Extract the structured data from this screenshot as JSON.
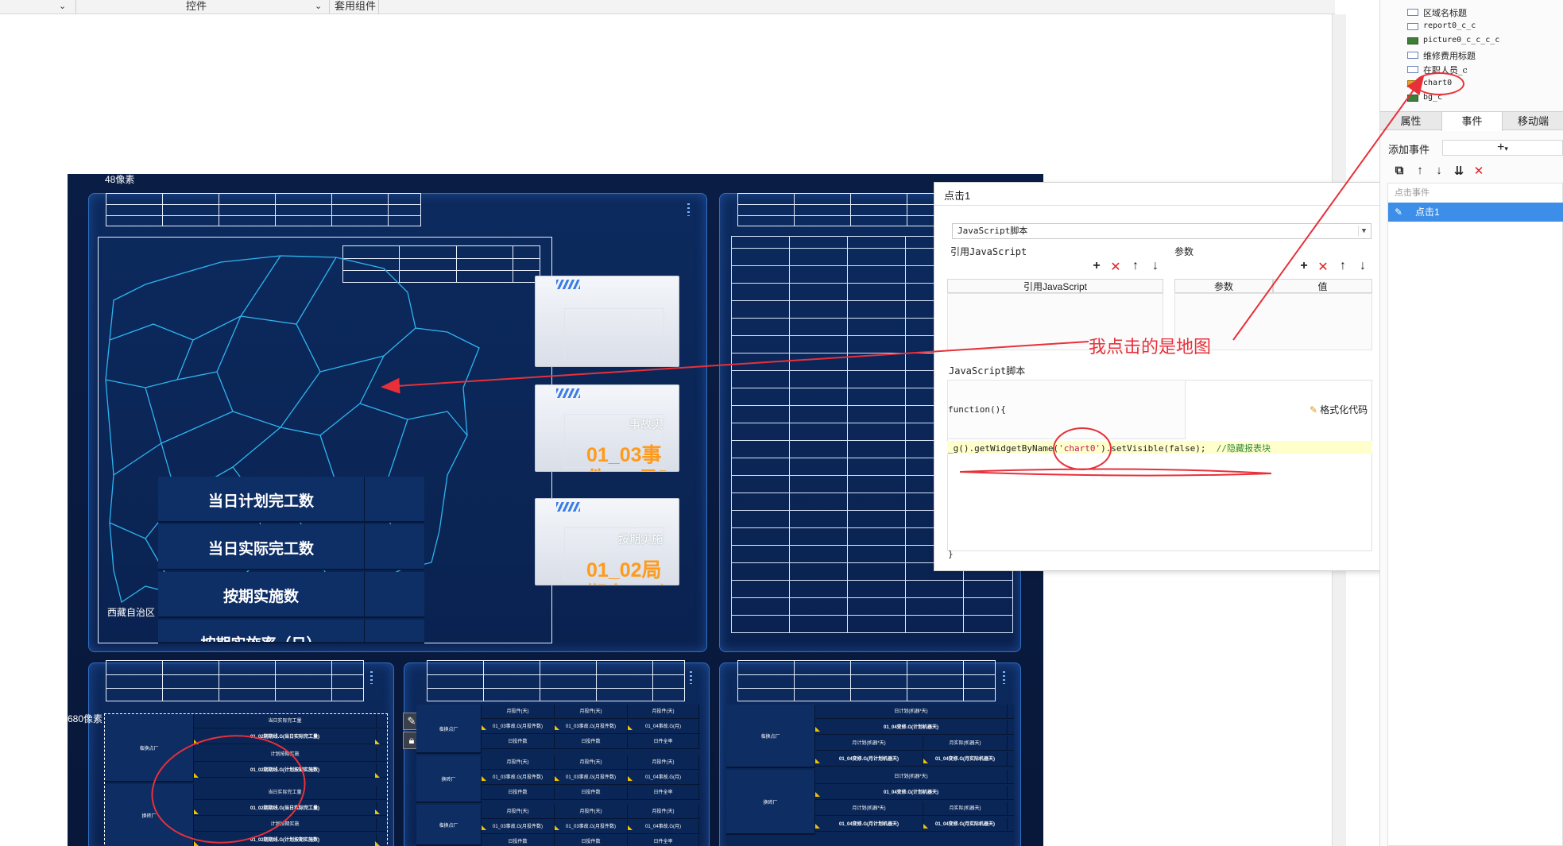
{
  "toolbar": {
    "controls_label": "控件",
    "components_label": "套用组件"
  },
  "canvas": {
    "px_label_top": "48像素",
    "px_label_left": "680像素",
    "map_region_label": "西藏自治区"
  },
  "stats": [
    {
      "label": "当日计划完工数"
    },
    {
      "label": "当日实际完工数"
    },
    {
      "label": "按期实施数"
    },
    {
      "label": "按期实施率（日）"
    }
  ],
  "cards": [
    {
      "title": "",
      "value": ""
    },
    {
      "title": "事故实",
      "value": "01_03事",
      "value2": "件_G 日实"
    },
    {
      "title": "按期实施",
      "value": "01_02局",
      "value2": "期实_G 计划"
    }
  ],
  "mini_table_left": {
    "groups": [
      "临换点厂",
      "换砖厂"
    ],
    "rows": [
      "当日实际完工量",
      "01_02期期线.G(当日实际完工量)",
      "计划按期实施",
      "01_02期期线.G(计划按期实施数)",
      "当日实际完工量",
      "01_02期期线.G(当日实际完工量)",
      "计划按期实施",
      "01_02期期线.G(计划按期实施数)"
    ]
  },
  "mini_table_mid": {
    "groups": [
      "临换点厂",
      "换砖厂",
      "临换点厂"
    ],
    "col_a": "月投件(天)",
    "col_b": "月投件(天)",
    "col_c": "月投件(天)",
    "cell_a": "01_03事故.G(月投件数)",
    "cell_b": "01_03事故.G(月投件数)",
    "cell_c": "01_04事故.G(月)",
    "sub_a": "日投件数",
    "sub_b": "日投件数",
    "sub_c": "日件全率"
  },
  "mini_table_right": {
    "groups": [
      "临换点厂",
      "换砖厂"
    ],
    "row_top": "日计划(机器*天)",
    "row_val": "01_04变修.G(计划机器天)",
    "col_l": "月计划(机器*天)",
    "col_r": "月实际(机器天)",
    "val_l": "01_04变修.G(月计划机器天)",
    "val_r": "01_04变修.G(月实际机器天)"
  },
  "dialog": {
    "title": "点击1",
    "script_type": "JavaScript脚本",
    "ref_js_label": "引用JavaScript",
    "params_label": "参数",
    "col_ref_js": "引用JavaScript",
    "col_param": "参数",
    "col_value": "值",
    "js_script_label": "JavaScript脚本",
    "format_code": "格式化代码",
    "code_fn_open": "function(){",
    "code_main_prefix": "_g().getWidgetByName(",
    "code_main_arg": "'chart0'",
    "code_main_suffix": ").setVisible(false);",
    "code_comment": "//隐藏报表块",
    "code_fn_close": "}"
  },
  "sidebar": {
    "tree": [
      {
        "label": "区域名标题",
        "icon": "widget-icon"
      },
      {
        "label": "report0_c_c",
        "icon": "widget-icon"
      },
      {
        "label": "picture0_c_c_c_c",
        "icon": "picture-icon"
      },
      {
        "label": "维修费用标题",
        "icon": "widget-icon"
      },
      {
        "label": "在职人员_c",
        "icon": "widget-icon"
      },
      {
        "label": "chart0",
        "icon": "chart-icon"
      },
      {
        "label": "bg_c",
        "icon": "picture-icon"
      }
    ],
    "tabs": [
      "属性",
      "事件",
      "移动端"
    ],
    "add_event_label": "添加事件",
    "event_list_header": "点击事件",
    "events": [
      "点击1"
    ]
  },
  "annotation": {
    "text": "我点击的是地图",
    "color": "#e8303a"
  },
  "colors": {
    "canvas_bg": "#0a1d45",
    "panel_border": "#2f6fc4",
    "card_value": "#ff9a1a",
    "selection_blue": "#3d8ee8"
  }
}
